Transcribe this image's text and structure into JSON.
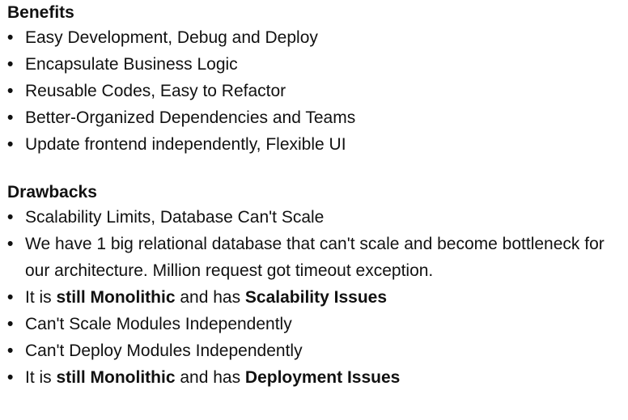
{
  "benefits": {
    "heading": "Benefits",
    "items": [
      "Easy Development, Debug and Deploy",
      "Encapsulate Business Logic",
      "Reusable Codes, Easy to Refactor",
      "Better-Organized Dependencies and Teams",
      "Update frontend independently, Flexible UI"
    ]
  },
  "drawbacks": {
    "heading": "Drawbacks",
    "items": [
      "Scalability Limits, Database Can't Scale",
      "We have 1 big relational database that can't scale and become bottleneck for our architecture. Million request got timeout exception."
    ],
    "monolithic_scalability": {
      "prefix": "It is ",
      "bold1": "still Monolithic",
      "middle": " and has ",
      "bold2": "Scalability Issues"
    },
    "items_more": [
      "Can't Scale Modules Independently",
      "Can't Deploy Modules Independently"
    ],
    "monolithic_deployment": {
      "prefix": "It is ",
      "bold1": "still Monolithic",
      "middle": " and has ",
      "bold2": "Deployment Issues"
    }
  },
  "bullet_glyph": "•"
}
